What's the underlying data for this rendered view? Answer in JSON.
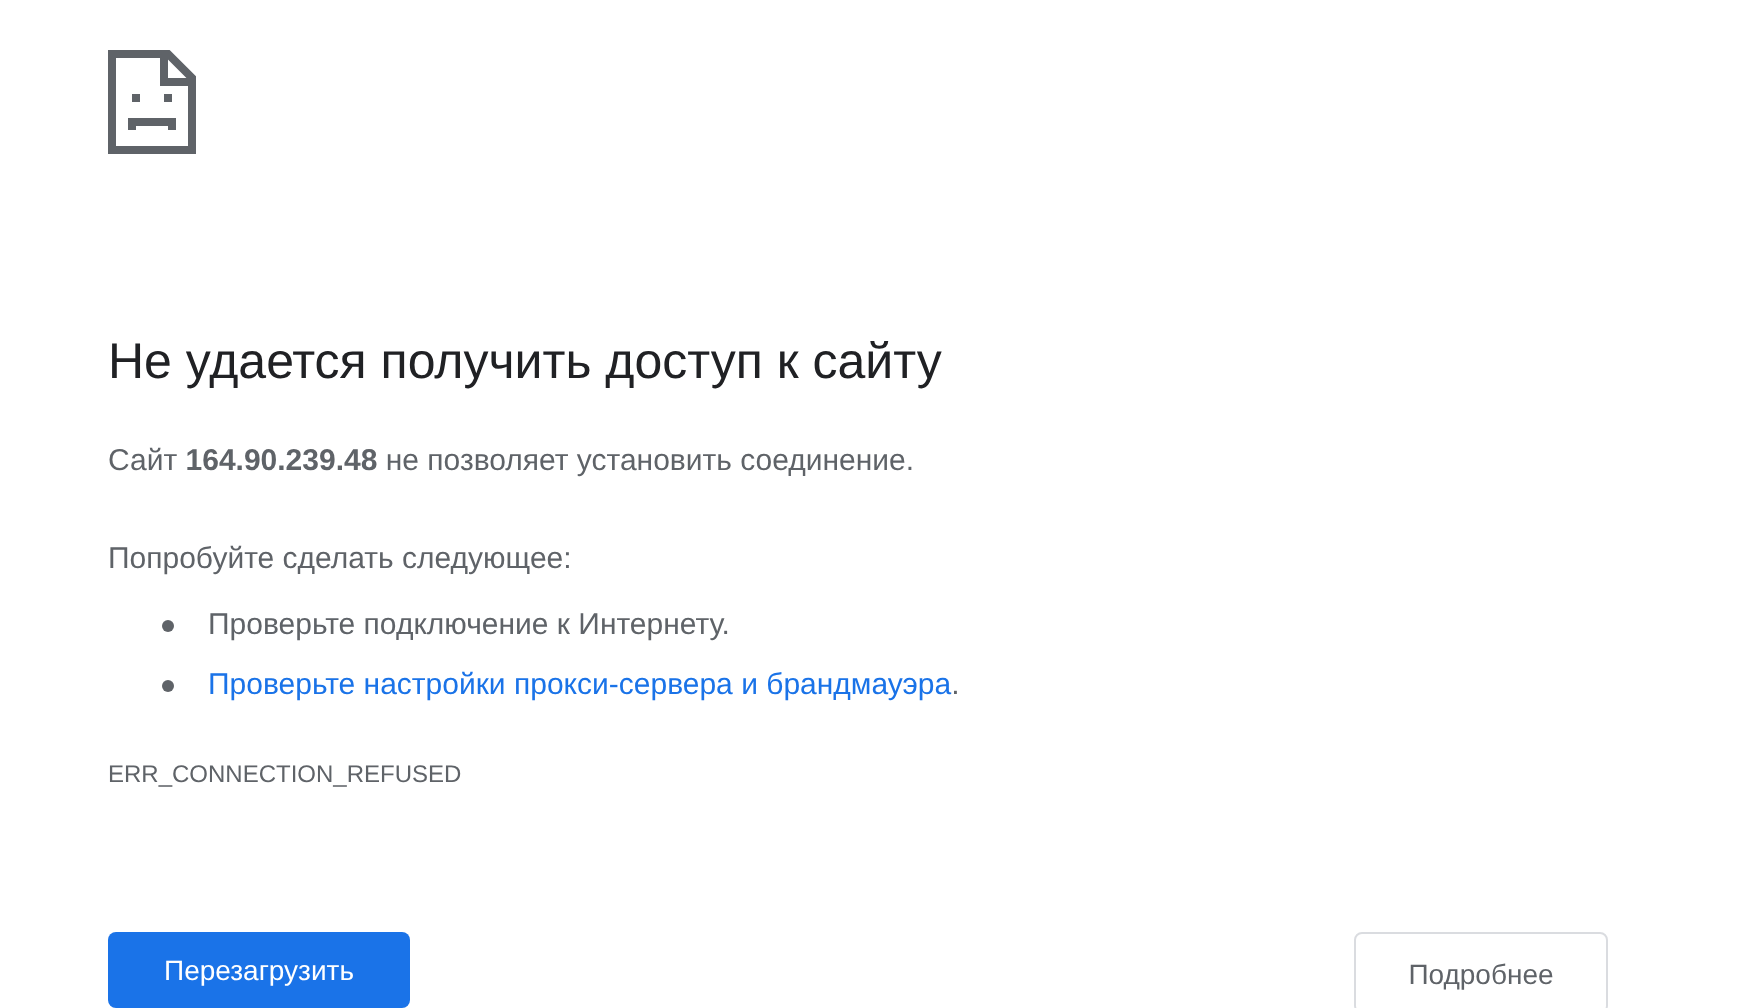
{
  "heading": "Не удается получить доступ к сайту",
  "summary": "Сайт **164.90.239.48** не позволяет установить соединение.",
  "suggestions_title": "Попробуйте сделать следующее:",
  "suggestions": [
    {
      "kind": "text",
      "text": "Проверьте подключение к Интернету."
    },
    {
      "kind": "link",
      "text": "Проверьте настройки прокси-сервера и брандмауэра",
      "after": "."
    }
  ],
  "error_code": "ERR_CONNECTION_REFUSED",
  "buttons": [
    {
      "kind": "primary",
      "label": "Перезагрузить"
    },
    {
      "kind": "secondary",
      "label": "Подробнее"
    }
  ]
}
